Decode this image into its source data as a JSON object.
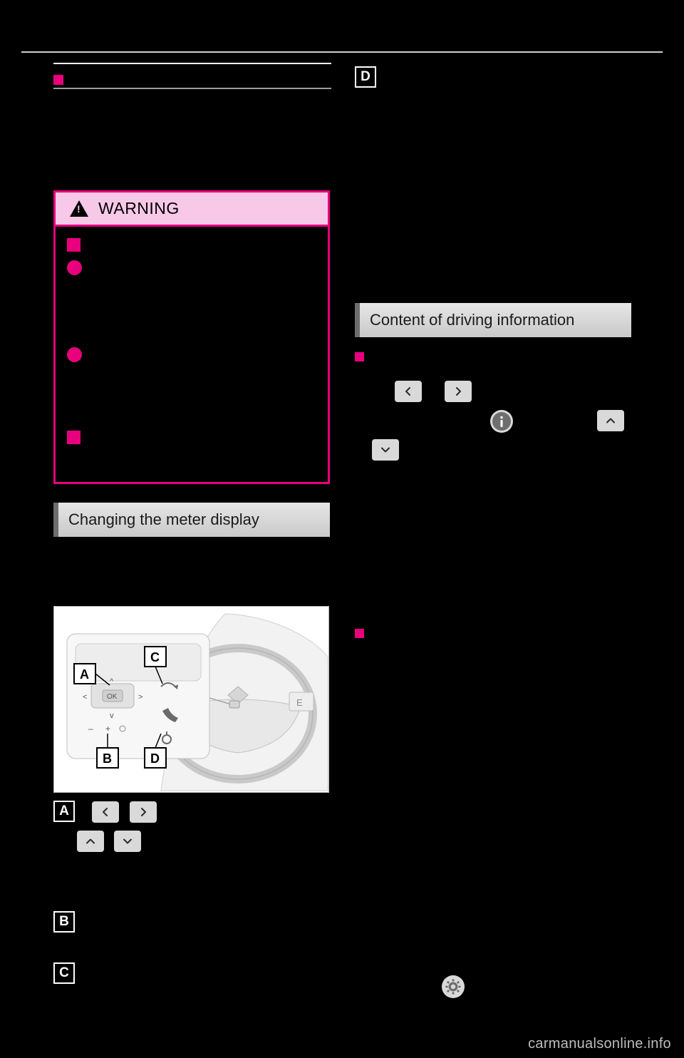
{
  "page": {
    "background_color": "#000000",
    "footer_watermark": "carmanualsonline.info"
  },
  "left_column": {
    "section1_heading": "",
    "warning": {
      "title": "WARNING",
      "icon": "warning-triangle-icon",
      "border_color": "#e8007d",
      "title_bg_color": "#f8c8e8",
      "items": [
        {
          "bullet": "square",
          "text": ""
        },
        {
          "bullet": "circle",
          "text": ""
        },
        {
          "bullet": "circle",
          "text": ""
        },
        {
          "bullet": "square",
          "text": ""
        }
      ]
    },
    "section2": {
      "heading": "Changing the meter display",
      "body": ""
    },
    "illustration": {
      "name": "steering-wheel-switch-illustration",
      "callouts": [
        "A",
        "B",
        "C",
        "D"
      ]
    },
    "callout_A": {
      "letter": "A",
      "buttons": [
        "<",
        ">",
        "^",
        "v"
      ],
      "description": ""
    },
    "callout_B": {
      "letter": "B",
      "description": ""
    },
    "callout_C": {
      "letter": "C",
      "description": ""
    }
  },
  "right_column": {
    "callout_D": {
      "letter": "D",
      "description": ""
    },
    "section": {
      "heading": "Content of driving information",
      "items": [
        {
          "bullet": "square",
          "text": ""
        },
        {
          "bullet": "square",
          "text": ""
        }
      ],
      "inline_buttons": [
        "<",
        ">",
        "info",
        "^",
        "v"
      ],
      "gear_button": "gear-icon"
    }
  }
}
